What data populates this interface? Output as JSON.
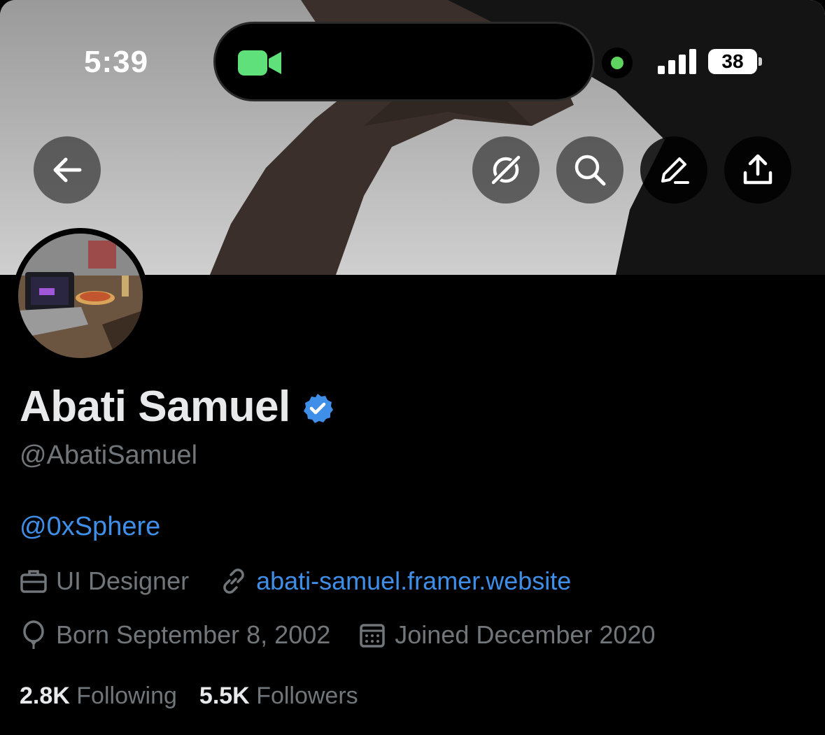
{
  "status_bar": {
    "time": "5:39",
    "battery": "38"
  },
  "header": {
    "buttons": [
      "back-icon",
      "grok-icon",
      "search-icon",
      "edit-icon",
      "share-icon"
    ]
  },
  "profile": {
    "name": "Abati Samuel",
    "handle": "@AbatiSamuel",
    "bio_link": "@0xSphere",
    "profession": "UI Designer",
    "website": "abati-samuel.framer.website",
    "birthday": "Born September 8, 2002",
    "joined": "Joined December 2020",
    "following_count": "2.8K",
    "following_label": "Following",
    "followers_count": "5.5K",
    "followers_label": "Followers"
  },
  "colors": {
    "background": "#000000",
    "accent": "#3f8fe8",
    "secondary_text": "#71767b",
    "primary_text": "#e7e9ea"
  }
}
